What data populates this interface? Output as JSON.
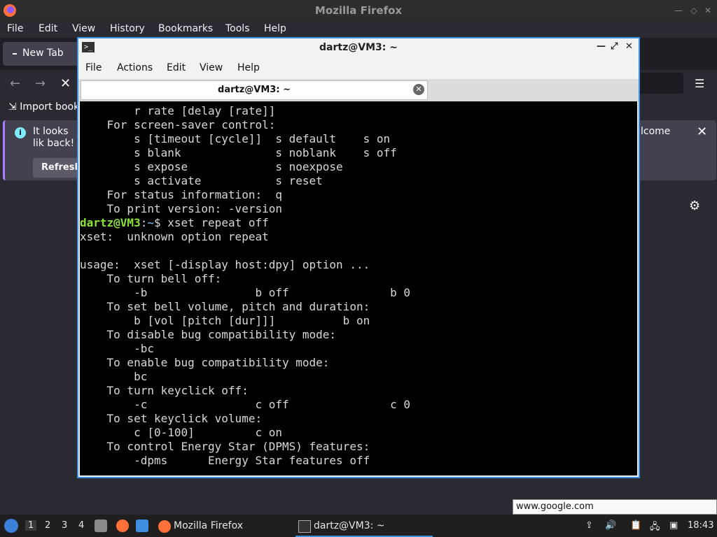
{
  "firefox": {
    "title": "Mozilla Firefox",
    "menu": [
      "File",
      "Edit",
      "View",
      "History",
      "Bookmarks",
      "Tools",
      "Help"
    ],
    "tab_label": "New Tab",
    "bookmark_item": "Import book",
    "notice": {
      "message_start": "It looks lik back!",
      "message_end": "lcome",
      "refresh_label": "Refresh"
    },
    "status_link": "www.google.com"
  },
  "terminal": {
    "title": "dartz@VM3: ~",
    "menu": [
      "File",
      "Actions",
      "Edit",
      "View",
      "Help"
    ],
    "tab_label": "dartz@VM3: ~",
    "prompt_user": "dartz@VM3",
    "prompt_sep": ":",
    "prompt_path": "~",
    "prompt_symbol": "$ ",
    "command": "xset repeat off",
    "lines_before": [
      "        r rate [delay [rate]]",
      "    For screen-saver control:",
      "        s [timeout [cycle]]  s default    s on",
      "        s blank              s noblank    s off",
      "        s expose             s noexpose",
      "        s activate           s reset",
      "    For status information:  q",
      "    To print version: -version"
    ],
    "lines_after": [
      "xset:  unknown option repeat",
      "",
      "usage:  xset [-display host:dpy] option ...",
      "    To turn bell off:",
      "        -b                b off               b 0",
      "    To set bell volume, pitch and duration:",
      "        b [vol [pitch [dur]]]          b on",
      "    To disable bug compatibility mode:",
      "        -bc",
      "    To enable bug compatibility mode:",
      "        bc",
      "    To turn keyclick off:",
      "        -c                c off               c 0",
      "    To set keyclick volume:",
      "        c [0-100]         c on",
      "    To control Energy Star (DPMS) features:",
      "        -dpms      Energy Star features off"
    ]
  },
  "taskbar": {
    "workspaces": [
      "1",
      "2",
      "3",
      "4"
    ],
    "task_firefox": "Mozilla Firefox",
    "task_terminal": "dartz@VM3: ~",
    "clock": "18:43"
  }
}
